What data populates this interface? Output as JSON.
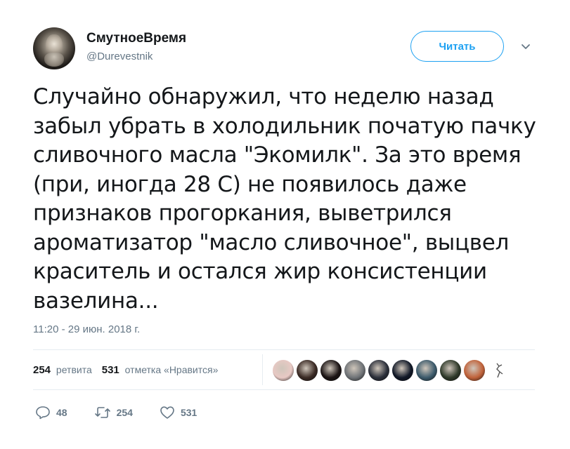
{
  "user": {
    "name": "СмутноеВремя",
    "handle": "@Durevestnik"
  },
  "follow_button": "Читать",
  "tweet": {
    "lines": [
      "Случайно обнаружил, что неделю назад",
      "забыл убрать в холодильник початую пачку",
      "сливочного масла \"Экомилк\". За это время",
      "(при, иногда  28 С) не появилось даже",
      "признаков прогоркания, выветрился",
      "ароматизатор \"масло сливочное\", выцвел",
      "краситель и остался жир консистенции",
      "вазелина..."
    ],
    "timestamp": "11:20 - 29 июн. 2018 г."
  },
  "stats": {
    "retweets_count": "254",
    "retweets_label": "ретвита",
    "likes_count": "531",
    "likes_label": "отметка «Нравится»"
  },
  "liker_colors": [
    "#e8c9c4",
    "#3a2a24",
    "#1b1414",
    "#6f7377",
    "#2b2f3a",
    "#111827",
    "#3c5a6b",
    "#2f3a2a",
    "#c0623a",
    "#ffffff"
  ],
  "actions": {
    "replies": "48",
    "retweets": "254",
    "likes": "531"
  },
  "colors": {
    "accent": "#1da1f2",
    "secondary_text": "#657786"
  }
}
